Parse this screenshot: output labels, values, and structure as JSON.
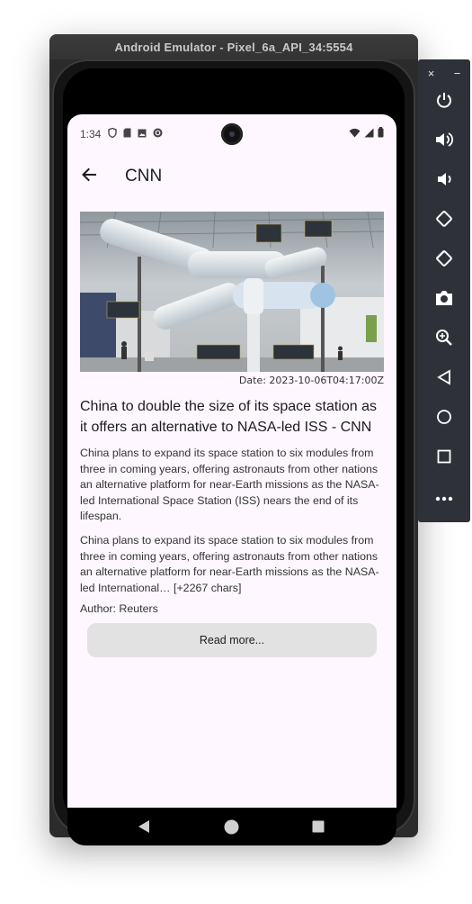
{
  "emulator": {
    "title": "Android Emulator - Pixel_6a_API_34:5554"
  },
  "status_bar": {
    "time": "1:34"
  },
  "app_bar": {
    "title": "CNN"
  },
  "article": {
    "date": "Date: 2023-10-06T04:17:00Z",
    "headline": "China to double the size of its space station as it offers an alternative to NASA-led ISS - CNN",
    "description": "China plans to expand its space station to six modules from three in coming years, offering astronauts from other nations an alternative platform for near-Earth missions as the NASA-led International Space Station (ISS) nears the end of its lifespan.",
    "content": "China plans to expand its space station to six modules from three in coming years, offering astronauts from other nations an alternative platform for near-Earth missions as the NASA-led International… [+2267 chars]",
    "author": "Author: Reuters",
    "read_more_label": "Read more..."
  },
  "toolbar": {
    "close_label": "×",
    "minimize_label": "−"
  }
}
